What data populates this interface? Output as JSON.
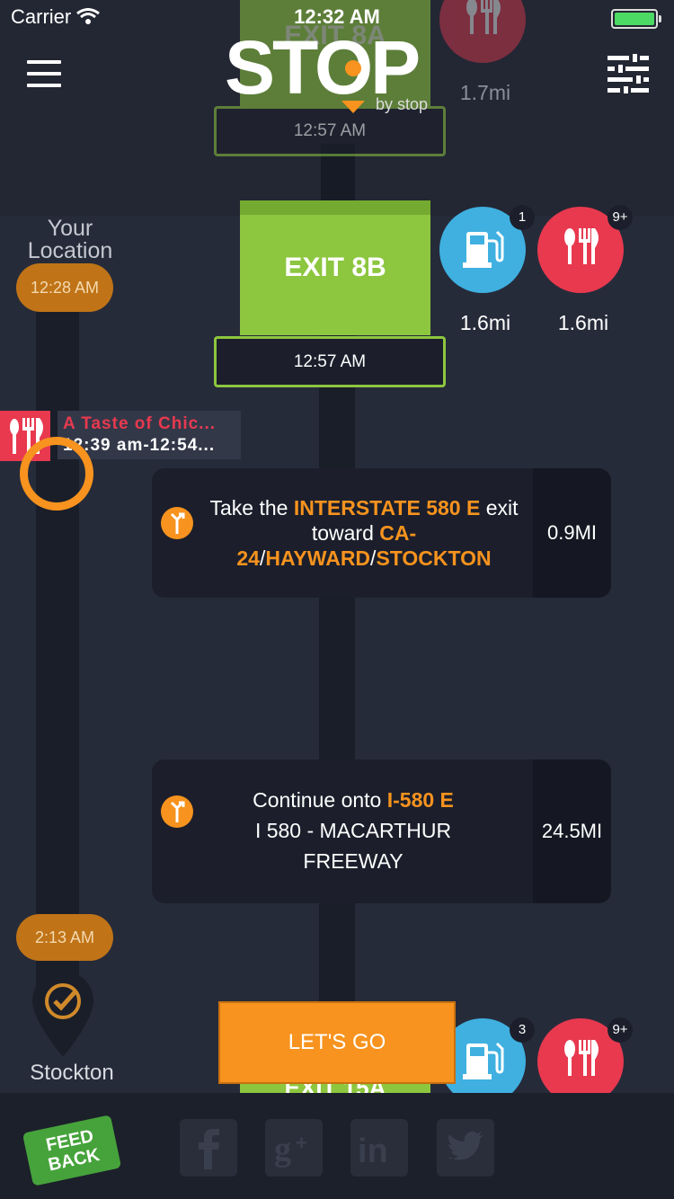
{
  "status_bar": {
    "carrier": "Carrier",
    "time": "12:32 AM"
  },
  "logo": {
    "word": "STOP",
    "sub": "by stop"
  },
  "top_exit": {
    "label": "EXIT 8A",
    "time": "12:57 AM",
    "food_distance": "1.7mi"
  },
  "main_exit": {
    "label": "EXIT 8B",
    "time": "12:57 AM",
    "gas": {
      "badge": "1",
      "distance": "1.6mi"
    },
    "food": {
      "badge": "9+",
      "distance": "1.6mi"
    }
  },
  "bottom_exit": {
    "label": "EXIT 15A",
    "gas": {
      "badge": "3"
    },
    "food": {
      "badge": "9+"
    }
  },
  "timeline": {
    "origin_label": "Your Location",
    "origin_time": "12:28 AM",
    "stop_name": "A Taste of Chic...",
    "stop_time": "12:39 am-12:54...",
    "destination_time": "2:13 AM",
    "destination_label": "Stockton"
  },
  "directions": [
    {
      "pre": "Take the ",
      "hl1": "INTERSTATE 580 E",
      "mid": " exit toward ",
      "hl2": "CA-24",
      "sep1": "/",
      "hl3": "HAYWARD",
      "sep2": "/",
      "hl4": "STOCKTON",
      "distance": "0.9MI"
    },
    {
      "pre": "Continue onto ",
      "hl1": "I-580 E",
      "line2": "I 580 - MACARTHUR",
      "line3": "FREEWAY",
      "distance": "24.5MI"
    }
  ],
  "cta": {
    "label": "LET'S GO"
  },
  "footer": {
    "feedback_line1": "FEED",
    "feedback_line2": "BACK"
  },
  "colors": {
    "accent": "#f7931e",
    "exit_green": "#8dc63f",
    "gas_blue": "#3fb0e0",
    "food_red": "#e8394f",
    "background": "#262b3a"
  }
}
